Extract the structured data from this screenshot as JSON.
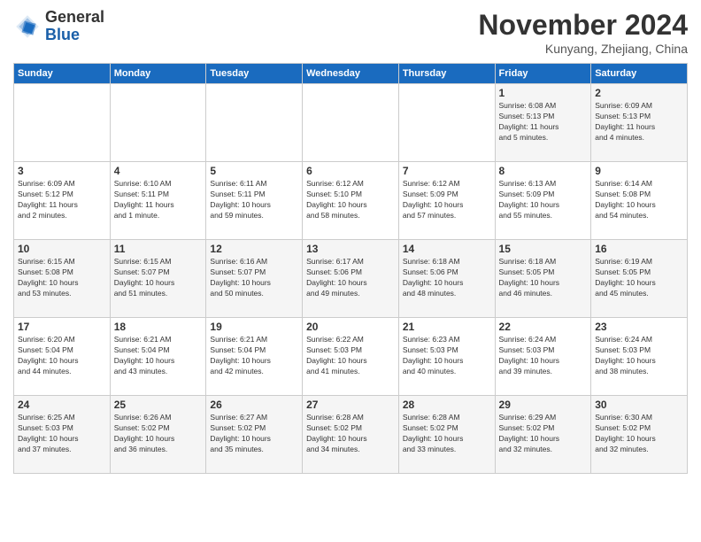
{
  "header": {
    "logo_general": "General",
    "logo_blue": "Blue",
    "month_title": "November 2024",
    "location": "Kunyang, Zhejiang, China"
  },
  "weekdays": [
    "Sunday",
    "Monday",
    "Tuesday",
    "Wednesday",
    "Thursday",
    "Friday",
    "Saturday"
  ],
  "weeks": [
    [
      {
        "day": "",
        "info": ""
      },
      {
        "day": "",
        "info": ""
      },
      {
        "day": "",
        "info": ""
      },
      {
        "day": "",
        "info": ""
      },
      {
        "day": "",
        "info": ""
      },
      {
        "day": "1",
        "info": "Sunrise: 6:08 AM\nSunset: 5:13 PM\nDaylight: 11 hours\nand 5 minutes."
      },
      {
        "day": "2",
        "info": "Sunrise: 6:09 AM\nSunset: 5:13 PM\nDaylight: 11 hours\nand 4 minutes."
      }
    ],
    [
      {
        "day": "3",
        "info": "Sunrise: 6:09 AM\nSunset: 5:12 PM\nDaylight: 11 hours\nand 2 minutes."
      },
      {
        "day": "4",
        "info": "Sunrise: 6:10 AM\nSunset: 5:11 PM\nDaylight: 11 hours\nand 1 minute."
      },
      {
        "day": "5",
        "info": "Sunrise: 6:11 AM\nSunset: 5:11 PM\nDaylight: 10 hours\nand 59 minutes."
      },
      {
        "day": "6",
        "info": "Sunrise: 6:12 AM\nSunset: 5:10 PM\nDaylight: 10 hours\nand 58 minutes."
      },
      {
        "day": "7",
        "info": "Sunrise: 6:12 AM\nSunset: 5:09 PM\nDaylight: 10 hours\nand 57 minutes."
      },
      {
        "day": "8",
        "info": "Sunrise: 6:13 AM\nSunset: 5:09 PM\nDaylight: 10 hours\nand 55 minutes."
      },
      {
        "day": "9",
        "info": "Sunrise: 6:14 AM\nSunset: 5:08 PM\nDaylight: 10 hours\nand 54 minutes."
      }
    ],
    [
      {
        "day": "10",
        "info": "Sunrise: 6:15 AM\nSunset: 5:08 PM\nDaylight: 10 hours\nand 53 minutes."
      },
      {
        "day": "11",
        "info": "Sunrise: 6:15 AM\nSunset: 5:07 PM\nDaylight: 10 hours\nand 51 minutes."
      },
      {
        "day": "12",
        "info": "Sunrise: 6:16 AM\nSunset: 5:07 PM\nDaylight: 10 hours\nand 50 minutes."
      },
      {
        "day": "13",
        "info": "Sunrise: 6:17 AM\nSunset: 5:06 PM\nDaylight: 10 hours\nand 49 minutes."
      },
      {
        "day": "14",
        "info": "Sunrise: 6:18 AM\nSunset: 5:06 PM\nDaylight: 10 hours\nand 48 minutes."
      },
      {
        "day": "15",
        "info": "Sunrise: 6:18 AM\nSunset: 5:05 PM\nDaylight: 10 hours\nand 46 minutes."
      },
      {
        "day": "16",
        "info": "Sunrise: 6:19 AM\nSunset: 5:05 PM\nDaylight: 10 hours\nand 45 minutes."
      }
    ],
    [
      {
        "day": "17",
        "info": "Sunrise: 6:20 AM\nSunset: 5:04 PM\nDaylight: 10 hours\nand 44 minutes."
      },
      {
        "day": "18",
        "info": "Sunrise: 6:21 AM\nSunset: 5:04 PM\nDaylight: 10 hours\nand 43 minutes."
      },
      {
        "day": "19",
        "info": "Sunrise: 6:21 AM\nSunset: 5:04 PM\nDaylight: 10 hours\nand 42 minutes."
      },
      {
        "day": "20",
        "info": "Sunrise: 6:22 AM\nSunset: 5:03 PM\nDaylight: 10 hours\nand 41 minutes."
      },
      {
        "day": "21",
        "info": "Sunrise: 6:23 AM\nSunset: 5:03 PM\nDaylight: 10 hours\nand 40 minutes."
      },
      {
        "day": "22",
        "info": "Sunrise: 6:24 AM\nSunset: 5:03 PM\nDaylight: 10 hours\nand 39 minutes."
      },
      {
        "day": "23",
        "info": "Sunrise: 6:24 AM\nSunset: 5:03 PM\nDaylight: 10 hours\nand 38 minutes."
      }
    ],
    [
      {
        "day": "24",
        "info": "Sunrise: 6:25 AM\nSunset: 5:03 PM\nDaylight: 10 hours\nand 37 minutes."
      },
      {
        "day": "25",
        "info": "Sunrise: 6:26 AM\nSunset: 5:02 PM\nDaylight: 10 hours\nand 36 minutes."
      },
      {
        "day": "26",
        "info": "Sunrise: 6:27 AM\nSunset: 5:02 PM\nDaylight: 10 hours\nand 35 minutes."
      },
      {
        "day": "27",
        "info": "Sunrise: 6:28 AM\nSunset: 5:02 PM\nDaylight: 10 hours\nand 34 minutes."
      },
      {
        "day": "28",
        "info": "Sunrise: 6:28 AM\nSunset: 5:02 PM\nDaylight: 10 hours\nand 33 minutes."
      },
      {
        "day": "29",
        "info": "Sunrise: 6:29 AM\nSunset: 5:02 PM\nDaylight: 10 hours\nand 32 minutes."
      },
      {
        "day": "30",
        "info": "Sunrise: 6:30 AM\nSunset: 5:02 PM\nDaylight: 10 hours\nand 32 minutes."
      }
    ]
  ]
}
